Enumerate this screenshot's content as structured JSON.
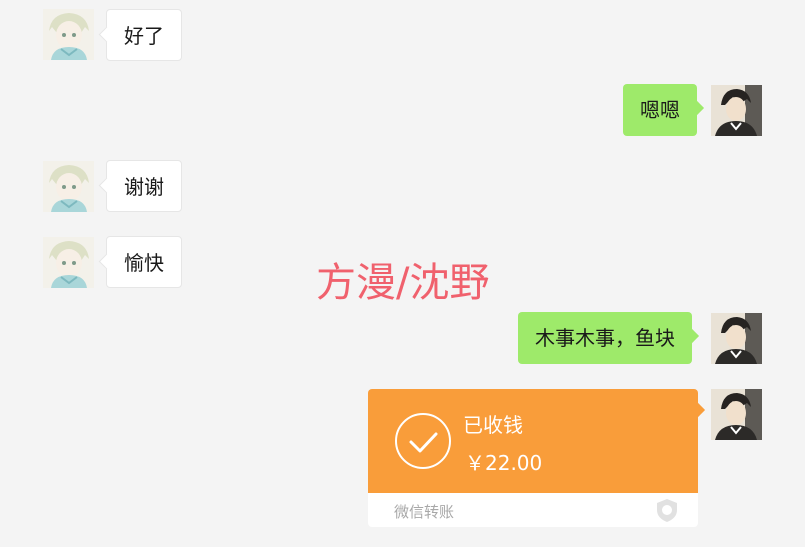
{
  "chat": {
    "messages": [
      {
        "side": "left",
        "text": "好了"
      },
      {
        "side": "right",
        "text": "嗯嗯"
      },
      {
        "side": "left",
        "text": "谢谢"
      },
      {
        "side": "left",
        "text": "愉快"
      },
      {
        "side": "right",
        "text": "木事木事，鱼块"
      }
    ],
    "watermark": "方漫/沈野",
    "transfer": {
      "status": "已收钱",
      "amount": "￥22.00",
      "label": "微信转账",
      "icon": "shield-icon"
    }
  },
  "colors": {
    "background": "#f4f4f4",
    "bubble_left": "#ffffff",
    "bubble_right": "#9eea6a",
    "transfer_orange": "#f99d3a",
    "watermark": "#f0616d"
  },
  "icons": {
    "left_avatar": "anime-boy-avatar",
    "right_avatar": "portrait-avatar",
    "check": "check-circle-icon"
  }
}
